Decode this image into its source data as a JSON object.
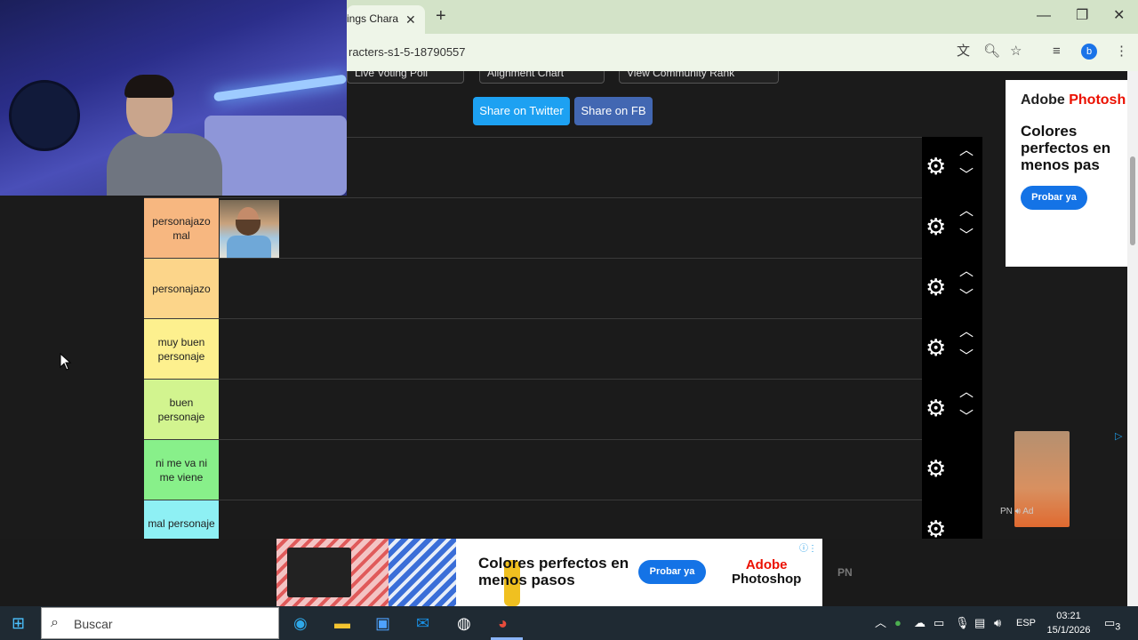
{
  "browser": {
    "tab_title": "ings Chara",
    "url": "racters-s1-5-18790557",
    "profile_initial": "b",
    "icons": [
      "translate-icon",
      "zoom-icon",
      "star-icon",
      "media-icon",
      "menu-icon"
    ]
  },
  "page": {
    "top_pills": [
      "Live Voting Poll",
      "Alignment Chart",
      "View Community Rank"
    ],
    "share_twitter": "Share on Twitter",
    "share_fb": "Share on FB",
    "tiers": [
      {
        "label": "",
        "color": "#1b1b1b"
      },
      {
        "label": "personajazo mal",
        "color": "#f7b780"
      },
      {
        "label": "personajazo",
        "color": "#fcd58a"
      },
      {
        "label": "muy buen personaje",
        "color": "#fdf08e"
      },
      {
        "label": "buen personaje",
        "color": "#d2f48f"
      },
      {
        "label": "ni me va ni me viene",
        "color": "#88f08a"
      },
      {
        "label": "mal personaje",
        "color": "#8ef0f4"
      }
    ]
  },
  "ads": {
    "right": {
      "brand_prefix": "Adobe",
      "brand": "Photosh",
      "headline": "Colores perfectos en menos pas",
      "cta": "Probar ya",
      "ad_label": "Ad",
      "pn_label": "PN"
    },
    "bottom": {
      "headline": "Colores perfectos en menos pasos",
      "cta": "Probar ya",
      "brand_prefix": "Adobe",
      "brand": "Photoshop",
      "pn_label": "PN"
    }
  },
  "taskbar": {
    "search_placeholder": "Buscar",
    "language": "ESP",
    "time": "03:21",
    "date": "15/1/2026",
    "notification_count": "3"
  }
}
